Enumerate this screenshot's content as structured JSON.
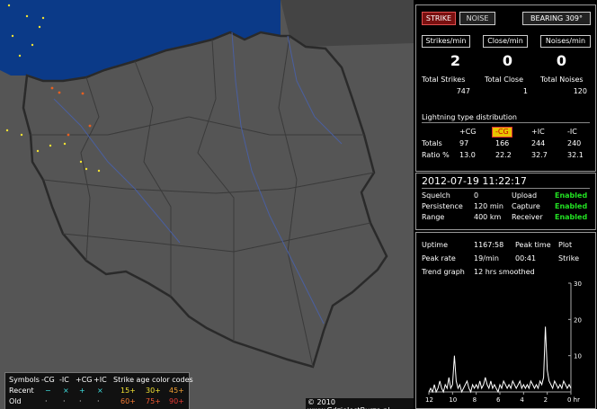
{
  "map": {
    "copyright": "© 2010 www.GdzieJestBurza.pl",
    "colors": {
      "land": "#555555",
      "sea": "#0b3a88",
      "borders": "#333333",
      "rivers": "#4a5fa0"
    }
  },
  "legend": {
    "header": [
      "Symbols",
      "-CG",
      "-IC",
      "+CG",
      "+IC",
      "Strike age color codes"
    ],
    "recent": {
      "label": "Recent",
      "symbols": [
        "−",
        "×",
        "+",
        "×"
      ],
      "ages": [
        "15+",
        "30+",
        "45+"
      ]
    },
    "old": {
      "label": "Old",
      "symbols": [
        "·",
        "·",
        "·",
        "·"
      ],
      "ages": [
        "60+",
        "75+",
        "90+"
      ]
    }
  },
  "top_buttons": {
    "strike": "STRIKE",
    "noise": "NOISE",
    "bearing": "BEARING 309°"
  },
  "rates": {
    "headers": [
      "Strikes/min",
      "Close/min",
      "Noises/min"
    ],
    "values": [
      "2",
      "0",
      "0"
    ]
  },
  "totals": {
    "labels": [
      "Total Strikes",
      "Total Close",
      "Total Noises"
    ],
    "values": [
      "747",
      "1",
      "120"
    ]
  },
  "distribution": {
    "title": "Lightning type distribution",
    "columns": [
      "+CG",
      "-CG",
      "+IC",
      "-IC"
    ],
    "totals_label": "Totals",
    "totals": [
      "97",
      "166",
      "244",
      "240"
    ],
    "ratio_label": "Ratio %",
    "ratio": [
      "13.0",
      "22.2",
      "32.7",
      "32.1"
    ]
  },
  "status": {
    "datetime": "2012-07-19 11:22:17",
    "squelch_label": "Squelch",
    "squelch": "0",
    "persistence_label": "Persistence",
    "persistence": "120 min",
    "range_label": "Range",
    "range": "400 km",
    "upload_label": "Upload",
    "upload": "Enabled",
    "capture_label": "Capture",
    "capture": "Enabled",
    "receiver_label": "Receiver",
    "receiver": "Enabled"
  },
  "stats": {
    "uptime_label": "Uptime",
    "uptime": "1167:58",
    "peak_time_label": "Peak time",
    "plot_label": "Plot",
    "peak_rate_label": "Peak rate",
    "peak_rate": "19/min",
    "peak_time": "00:41",
    "plot": "Strike",
    "trend_label": "Trend graph",
    "trend": "12 hrs smoothed"
  },
  "chart_data": {
    "type": "line",
    "x_ticks": [
      "12",
      "10",
      "8",
      "6",
      "4",
      "2",
      "0 hr"
    ],
    "y_ticks": [
      "30",
      "20",
      "10"
    ],
    "ylim": [
      0,
      30
    ],
    "xlim": [
      12,
      0
    ],
    "series": [
      {
        "values": [
          0,
          1,
          0,
          2,
          0,
          1,
          3,
          1,
          0,
          2,
          1,
          4,
          1,
          2,
          10,
          3,
          1,
          2,
          0,
          1,
          2,
          3,
          1,
          0,
          2,
          1,
          2,
          1,
          3,
          1,
          2,
          4,
          2,
          1,
          3,
          1,
          2,
          1,
          0,
          2,
          1,
          3,
          2,
          1,
          2,
          1,
          3,
          2,
          1,
          2,
          3,
          1,
          2,
          1,
          2,
          1,
          3,
          2,
          1,
          2,
          1,
          3,
          2,
          4,
          18,
          6,
          3,
          2,
          1,
          3,
          2,
          1,
          2,
          1,
          3,
          2,
          1,
          2,
          1
        ]
      }
    ]
  }
}
